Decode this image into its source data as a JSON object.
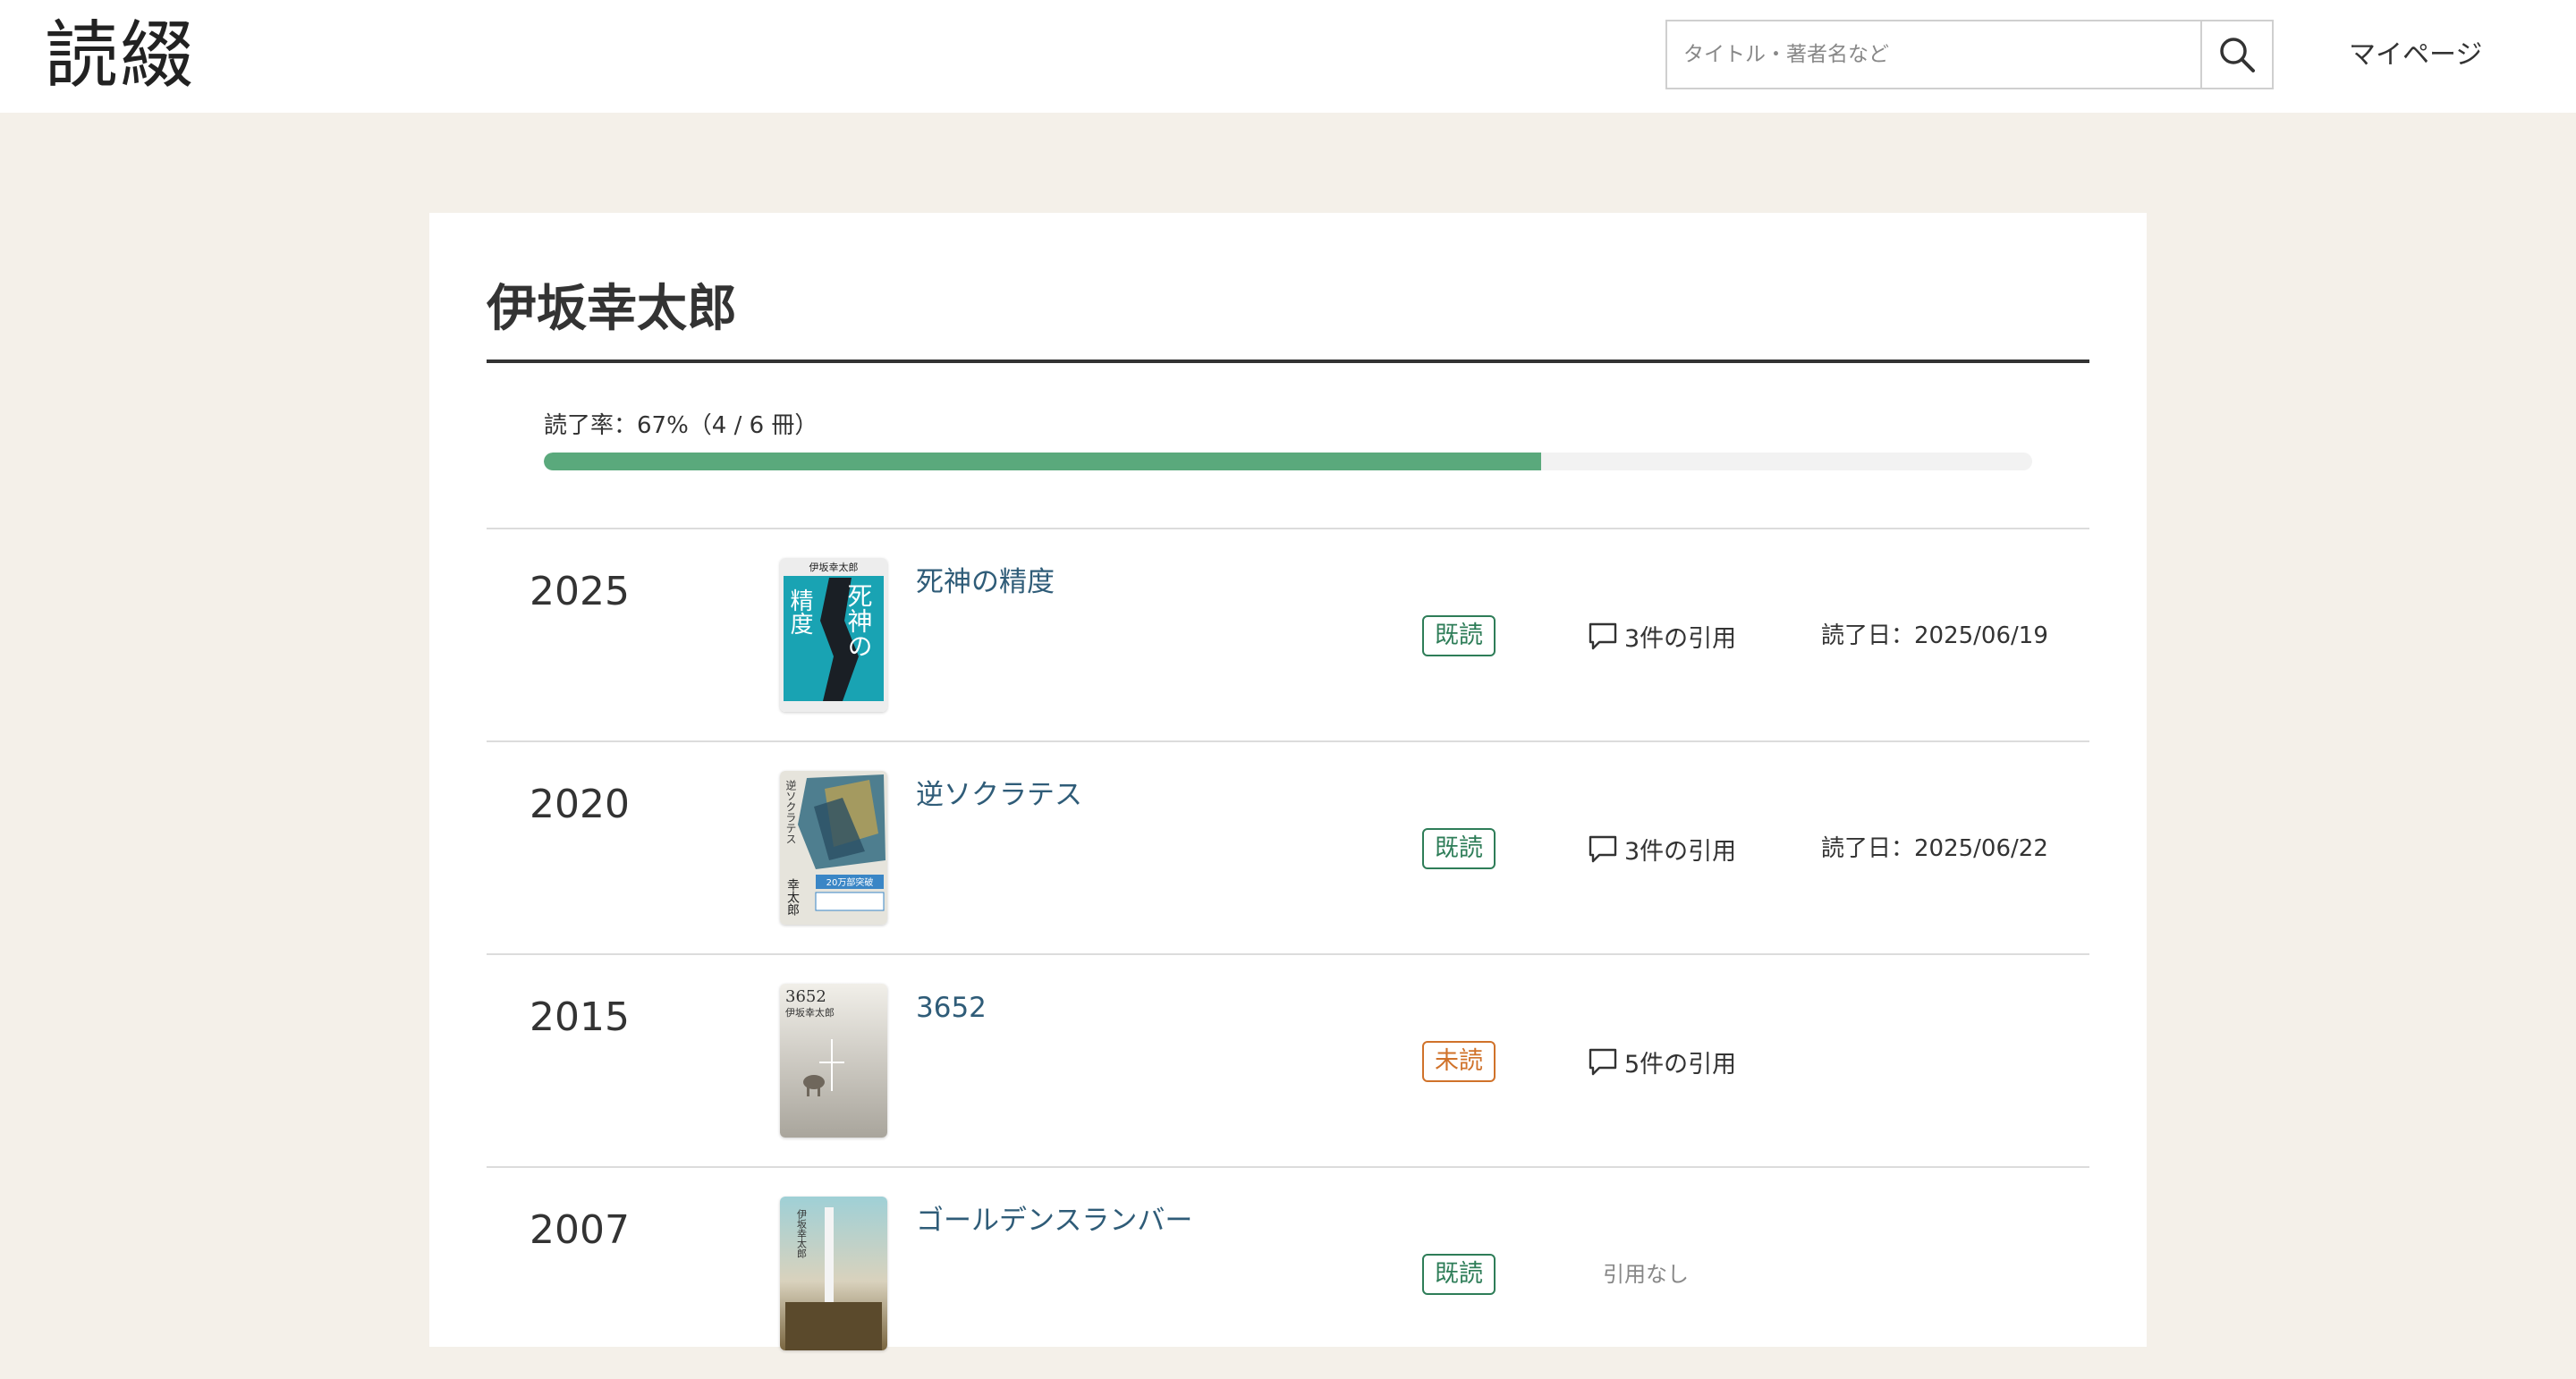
{
  "header": {
    "logo": "読綴",
    "search_placeholder": "タイトル・著者名など",
    "mypage_label": "マイページ"
  },
  "author": {
    "name": "伊坂幸太郎",
    "progress_text": "読了率：67%（4 / 6 冊）",
    "progress_ratio": 0.67
  },
  "books": [
    {
      "year": "2025",
      "title": "死神の精度",
      "status": "既読",
      "status_type": "read",
      "quotes": "3件の引用",
      "read_date": "読了日：2025/06/19",
      "cover_lines": [
        "伊坂幸太郎",
        "死神の",
        "精度"
      ]
    },
    {
      "year": "2020",
      "title": "逆ソクラテス",
      "status": "既読",
      "status_type": "read",
      "quotes": "3件の引用",
      "read_date": "読了日：2025/06/22",
      "cover_lines": [
        "逆ソクラテス",
        "幸太郎",
        "20万部突破"
      ]
    },
    {
      "year": "2015",
      "title": "3652",
      "status": "未読",
      "status_type": "unread",
      "quotes": "5件の引用",
      "read_date": "",
      "cover_lines": [
        "3652",
        "伊坂幸太郎"
      ]
    },
    {
      "year": "2007",
      "title": "ゴールデンスランバー",
      "status": "既読",
      "status_type": "read",
      "quotes": "",
      "quotes_none": "引用なし",
      "read_date": "",
      "cover_lines": [
        "伊坂幸太郎"
      ]
    }
  ],
  "colors": {
    "page_bg": "#f4f0e9",
    "progress": "#5aa97c",
    "read": "#2e7d58",
    "unread": "#d0722a",
    "title_link": "#2f5c78"
  },
  "icons": {
    "search": "search-icon",
    "quote": "speech-bubble-icon"
  }
}
